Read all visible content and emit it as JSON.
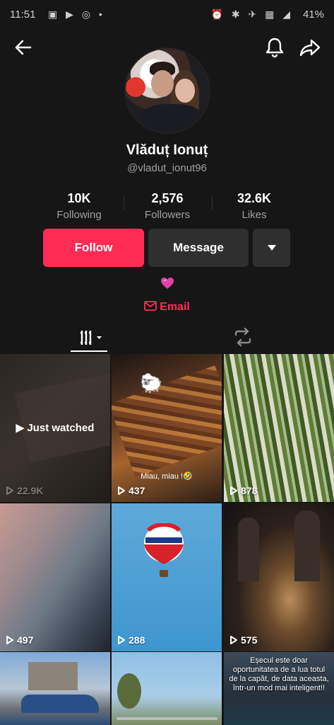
{
  "status_bar": {
    "time": "11:51",
    "battery": "41%"
  },
  "header": {
    "back_icon": "arrow-left-icon",
    "bell_icon": "bell-icon",
    "share_icon": "share-icon"
  },
  "profile": {
    "display_name": "Vlăduț Ionuț",
    "username": "@vladut_ionut96",
    "stats": [
      {
        "value": "10K",
        "label": "Following"
      },
      {
        "value": "2,576",
        "label": "Followers"
      },
      {
        "value": "32.6K",
        "label": "Likes"
      }
    ],
    "buttons": {
      "follow": "Follow",
      "message": "Message"
    },
    "email_label": "Email"
  },
  "colors": {
    "accent": "#fe2c55",
    "background": "#161616",
    "button_dark": "#2f2f2f"
  },
  "videos": [
    {
      "views": "22.9K",
      "overlay": "Just watched",
      "dim": true
    },
    {
      "views": "437",
      "caption": "Miau, miau !🤣"
    },
    {
      "views": "878"
    },
    {
      "views": "497"
    },
    {
      "views": "288"
    },
    {
      "views": "575"
    },
    {
      "views": ""
    },
    {
      "views": ""
    },
    {
      "views": "",
      "overlay_text": "Eșecul este doar oportunitatea de a lua totul de la capăt, de data aceasta, într-un mod mai inteligent!!"
    }
  ]
}
